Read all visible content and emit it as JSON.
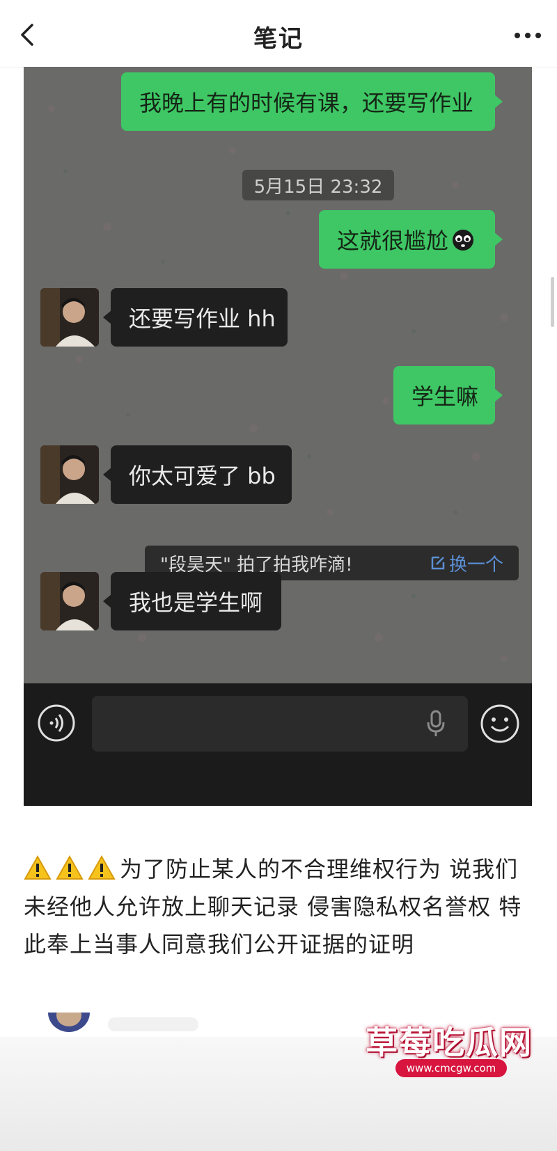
{
  "header": {
    "title": "笔记",
    "back_icon": "chevron-left-icon",
    "more_icon": "more-dots-icon"
  },
  "chat": {
    "messages": [
      {
        "side": "out",
        "text": "我晚上有的时候有课，还要写作业"
      },
      {
        "side": "out",
        "text": "这就很尴尬",
        "emoji": "awkward-face-icon"
      },
      {
        "side": "in",
        "text": "还要写作业 hh"
      },
      {
        "side": "out",
        "text": "学生嘛"
      },
      {
        "side": "in",
        "text": "你太可爱了 bb"
      },
      {
        "side": "in",
        "text": "我也是学生啊"
      }
    ],
    "timestamp": "5月15日 23:32",
    "pat_notice": {
      "text": "\"段昊天\" 拍了拍我咋滴!",
      "action_label": "换一个",
      "action_icon": "edit-icon"
    },
    "input_bar": {
      "voice_icon": "voice-icon",
      "mic_icon": "mic-icon",
      "emoji_icon": "emoji-icon"
    },
    "colors": {
      "out_bubble": "#3ec764",
      "in_bubble": "#1f1f1f",
      "background": "#6a6a68"
    }
  },
  "caption": {
    "warning_icon": "warning-icon",
    "text": "为了防止某人的不合理维权行为 说我们未经他人允许放上聊天记录 侵害隐私权名誉权 特此奉上当事人同意我们公开证据的证明"
  },
  "watermark": {
    "title": "草莓吃瓜网",
    "url": "www.cmcgw.com"
  }
}
